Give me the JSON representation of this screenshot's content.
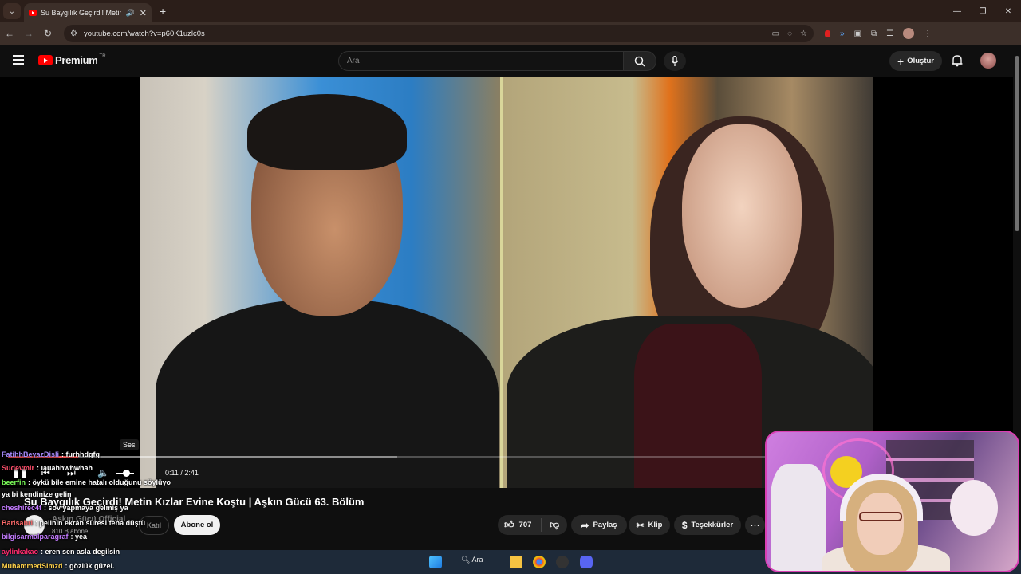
{
  "browser": {
    "tab_title": "Su Baygılık Geçirdi! Metin K",
    "url": "youtube.com/watch?v=p60K1uzlc0s"
  },
  "youtube": {
    "logo_text": "Premium",
    "country_code": "TR",
    "search_placeholder": "Ara",
    "create_label": "Oluştur"
  },
  "player": {
    "volume_tooltip": "Ses",
    "time": "0:11 / 2:41",
    "progress_fraction": 0.07
  },
  "video": {
    "title": "Su Baygılık Geçirdi! Metin Kızlar Evine Koştu | Aşkın Gücü 63. Bölüm",
    "channel": "Aşkın Gücü Official",
    "subscribers": "810 B abone",
    "join_label": "Katıl",
    "subscribe_label": "Abone ol",
    "likes": "707",
    "share_label": "Paylaş",
    "clip_label": "Klip",
    "thanks_label": "Teşekkürler"
  },
  "chat": [
    {
      "user": "FatihhBeyazDisli",
      "text": "furhhdgfg",
      "color": "#a98cff"
    },
    {
      "user": "Sudevmir",
      "text": "ıauahhwhwhah",
      "color": "#ff4f6b"
    },
    {
      "user": "beerfin",
      "text": "öykü bile emine hatalı olduğunu söylüyo",
      "color": "#7cff5a"
    },
    {
      "user": "",
      "text": "ya bi kendinize gelin",
      "color": "#ffffff"
    },
    {
      "user": "cheshirec4t",
      "text": "sov yapmaya gelmiş ya",
      "color": "#c47cff"
    },
    {
      "user": "Barisabri",
      "text": "pelinin ekran süresi fena düştü",
      "color": "#ff6b6b"
    },
    {
      "user": "bilgisarmalparagraf",
      "text": "yea",
      "color": "#c47cff"
    },
    {
      "user": "aylinkakao",
      "text": "eren sen asla degilsin",
      "color": "#ff2b6d"
    },
    {
      "user": "MuhammedSlmzd",
      "text": "gözlük güzel.",
      "color": "#ffd34d"
    }
  ],
  "taskbar": {
    "search_label": "Ara"
  }
}
